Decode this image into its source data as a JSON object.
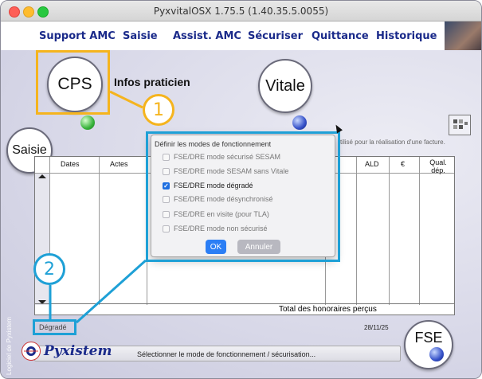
{
  "window": {
    "title": "PyxvitalOSX 1.75.5 (1.40.35.5.0055)"
  },
  "menu": [
    {
      "label": "Support AMC"
    },
    {
      "label": "Saisie"
    },
    {
      "label": "Assist. AMC"
    },
    {
      "label": "Sécuriser"
    },
    {
      "label": "Quittance"
    },
    {
      "label": "Historique"
    }
  ],
  "buttons": {
    "cps": "CPS",
    "vitale": "Vitale",
    "saisie": "Saisie",
    "fse": "FSE"
  },
  "infos_praticien": "Infos praticien",
  "hint_text": "tilisé pour la réalisation d'une facture.",
  "callouts": {
    "one": "1",
    "two": "2"
  },
  "table": {
    "headers": [
      "Dates",
      "Actes",
      "ALD",
      "€",
      "Qual. dép."
    ],
    "total_label": "Total des honoraires perçus"
  },
  "dialog": {
    "title": "Définir les modes de fonctionnement",
    "options": [
      {
        "label": "FSE/DRE mode sécurisé SESAM",
        "checked": false
      },
      {
        "label": "FSE/DRE mode SESAM sans Vitale",
        "checked": false
      },
      {
        "label": "FSE/DRE mode dégradé",
        "checked": true
      },
      {
        "label": "FSE/DRE mode désynchronisé",
        "checked": false
      },
      {
        "label": "FSE/DRE en visite (pour TLA)",
        "checked": false
      },
      {
        "label": "FSE/DRE mode non sécurisé",
        "checked": false
      }
    ],
    "ok": "OK",
    "cancel": "Annuler"
  },
  "mode_label": "Dégradé",
  "date": "28/11/25",
  "status": "Sélectionner le mode de fonctionnement / sécurisation...",
  "logo_text": "Pyxistem",
  "side_text": "Logiciel de Pyxistem",
  "colors": {
    "callout_orange": "#f5b41e",
    "callout_cyan": "#1ea0d6",
    "menu_blue": "#1a2a8a"
  }
}
